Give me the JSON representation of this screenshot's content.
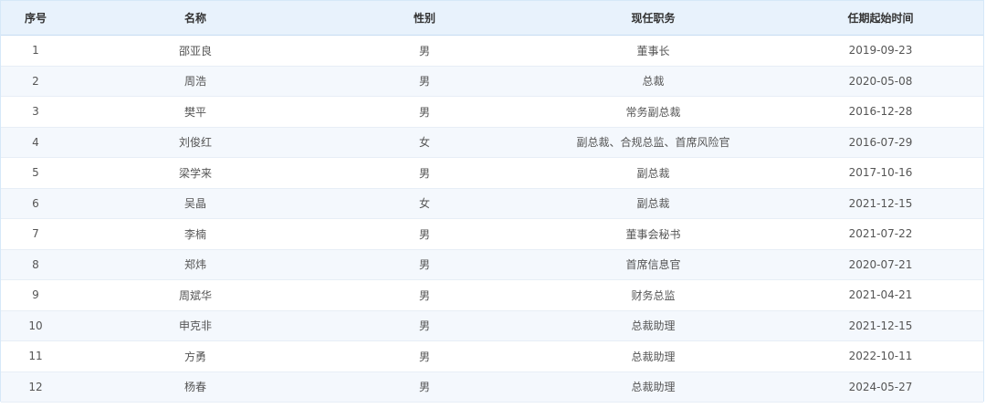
{
  "table": {
    "headers": [
      "序号",
      "名称",
      "性别",
      "现任职务",
      "任期起始时间"
    ],
    "rows": [
      [
        "1",
        "邵亚良",
        "男",
        "董事长",
        "2019-09-23"
      ],
      [
        "2",
        "周浩",
        "男",
        "总裁",
        "2020-05-08"
      ],
      [
        "3",
        "樊平",
        "男",
        "常务副总裁",
        "2016-12-28"
      ],
      [
        "4",
        "刘俊红",
        "女",
        "副总裁、合规总监、首席风险官",
        "2016-07-29"
      ],
      [
        "5",
        "梁学来",
        "男",
        "副总裁",
        "2017-10-16"
      ],
      [
        "6",
        "吴晶",
        "女",
        "副总裁",
        "2021-12-15"
      ],
      [
        "7",
        "李楠",
        "男",
        "董事会秘书",
        "2021-07-22"
      ],
      [
        "8",
        "郑炜",
        "男",
        "首席信息官",
        "2020-07-21"
      ],
      [
        "9",
        "周斌华",
        "男",
        "财务总监",
        "2021-04-21"
      ],
      [
        "10",
        "申克非",
        "男",
        "总裁助理",
        "2021-12-15"
      ],
      [
        "11",
        "方勇",
        "男",
        "总裁助理",
        "2022-10-11"
      ],
      [
        "12",
        "杨春",
        "男",
        "总裁助理",
        "2024-05-27"
      ]
    ]
  }
}
